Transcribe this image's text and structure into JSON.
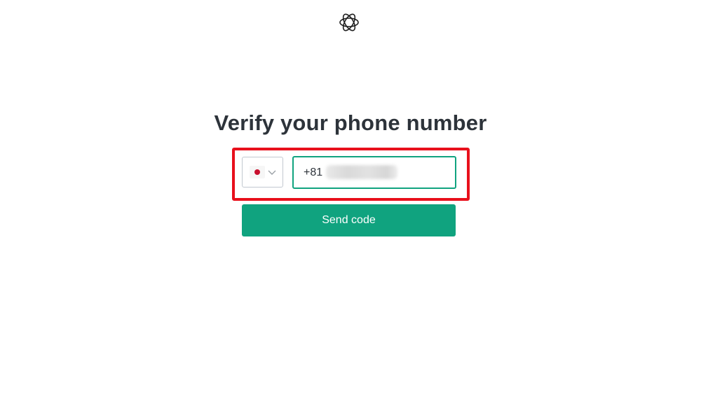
{
  "page": {
    "title": "Verify your phone number"
  },
  "logo": {
    "icon": "openai-logo-icon"
  },
  "phone": {
    "country_flag": "japan-flag-icon",
    "country_dropdown_icon": "chevron-down-icon",
    "dial_code": "+81"
  },
  "actions": {
    "send_code_label": "Send code"
  },
  "colors": {
    "accent": "#10a37f",
    "highlight": "#e8101c",
    "title_text": "#2d333a",
    "flag_red": "#c8102e"
  }
}
